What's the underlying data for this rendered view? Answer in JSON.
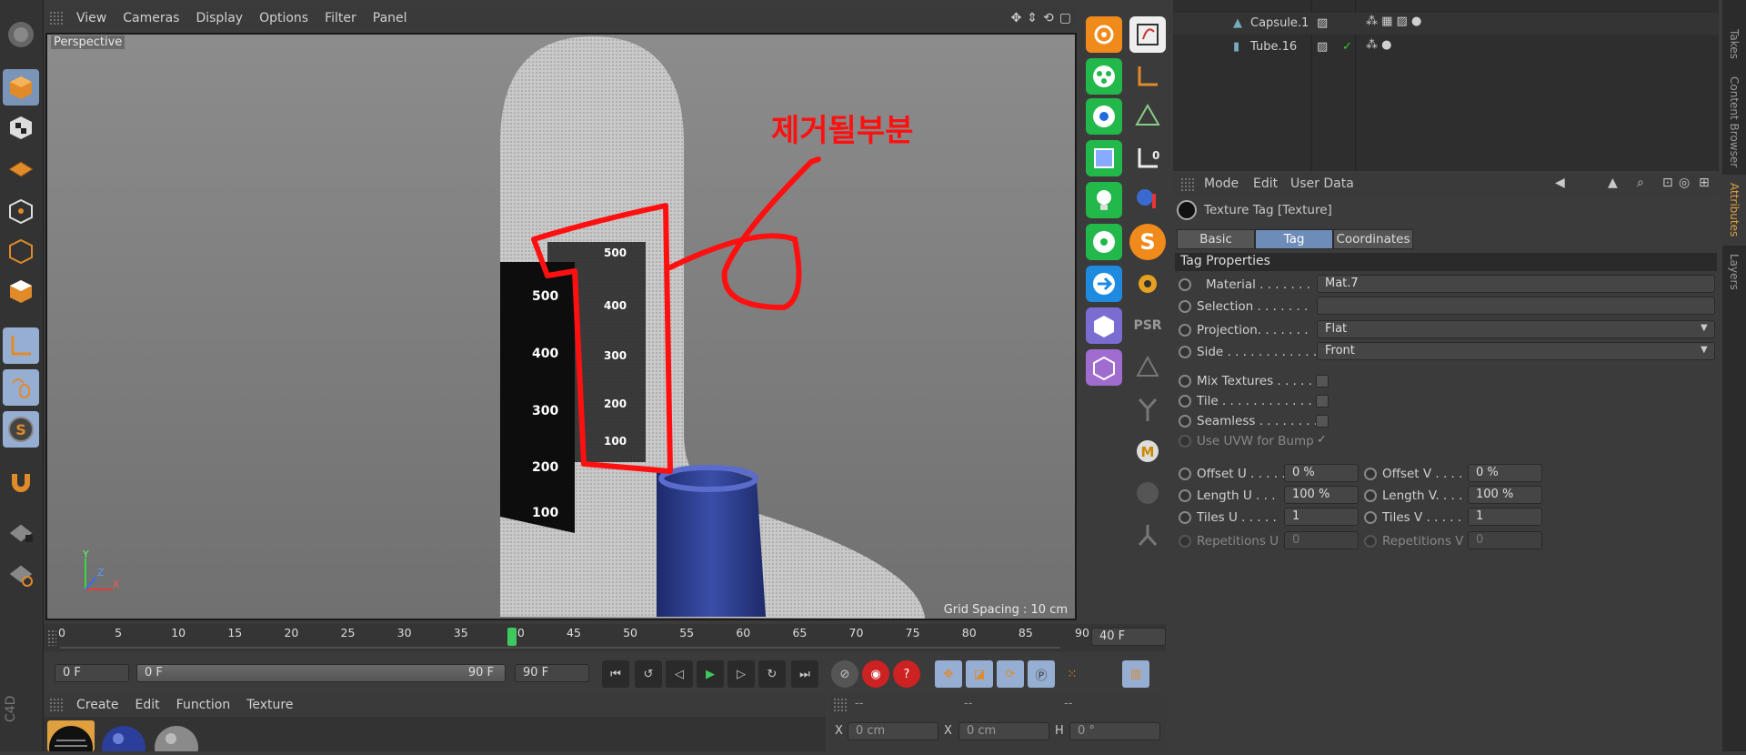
{
  "viewport": {
    "menu": [
      "View",
      "Cameras",
      "Display",
      "Options",
      "Filter",
      "Panel"
    ],
    "camera_label": "Perspective",
    "annotation": "제거될부분",
    "grid_spacing": "Grid Spacing : 10 cm",
    "axis_y": "Y",
    "axis_z": "Z",
    "axis_x": "X",
    "front_scale": [
      "500",
      "400",
      "300",
      "200",
      "100"
    ],
    "back_scale": [
      "500",
      "400",
      "300",
      "200",
      "100"
    ]
  },
  "object_manager": {
    "items": [
      {
        "name": "Capsule.1"
      },
      {
        "name": "Tube.16"
      }
    ]
  },
  "attributes": {
    "menu": [
      "Mode",
      "Edit",
      "User Data"
    ],
    "header": "Texture Tag [Texture]",
    "tabs": [
      "Basic",
      "Tag",
      "Coordinates"
    ],
    "section": "Tag Properties",
    "material_label": "Material . . . . . . .",
    "material_value": "Mat.7",
    "selection_label": "Selection . . . . . . .",
    "projection_label": "Projection. . . . . . .",
    "projection_value": "Flat",
    "side_label": "Side . . . . . . . . . . . .",
    "side_value": "Front",
    "mix_label": "Mix Textures . . . . .",
    "tile_label": "Tile . . . . . . . . . . . .",
    "seamless_label": "Seamless . . . . . . . .",
    "uvw_label": "Use UVW for Bump",
    "uvw_check": "✓",
    "offset_u_label": "Offset U . . . . .",
    "offset_u": "0 %",
    "offset_v_label": "Offset V . . . . .",
    "offset_v": "0 %",
    "length_u_label": "Length U . . .",
    "length_u": "100 %",
    "length_v_label": "Length V. . . .",
    "length_v": "100 %",
    "tiles_u_label": "Tiles U . . . . .",
    "tiles_u": "1",
    "tiles_v_label": "Tiles V . . . . .",
    "tiles_v": "1",
    "rep_u_label": "Repetitions U",
    "rep_u": "0",
    "rep_v_label": "Repetitions V",
    "rep_v": "0"
  },
  "side_tabs": [
    "Takes",
    "Content Browser",
    "Attributes",
    "Layers"
  ],
  "timeline": {
    "ticks": [
      "0",
      "5",
      "10",
      "15",
      "20",
      "25",
      "30",
      "35",
      "40",
      "45",
      "50",
      "55",
      "60",
      "65",
      "70",
      "75",
      "80",
      "85",
      "90"
    ],
    "current_frame": "40 F",
    "start_frame": "0 F",
    "range_start": "0 F",
    "range_end": "90 F",
    "end_frame": "90 F"
  },
  "material_manager": {
    "menu": [
      "Create",
      "Edit",
      "Function",
      "Texture"
    ]
  },
  "coordinates": {
    "header": [
      "--",
      "--",
      "--"
    ],
    "x_label": "X",
    "x_value": "0 cm",
    "x2_label": "X",
    "x2_value": "0 cm",
    "h_label": "H",
    "h_value": "0 °"
  },
  "brand": "C4D"
}
